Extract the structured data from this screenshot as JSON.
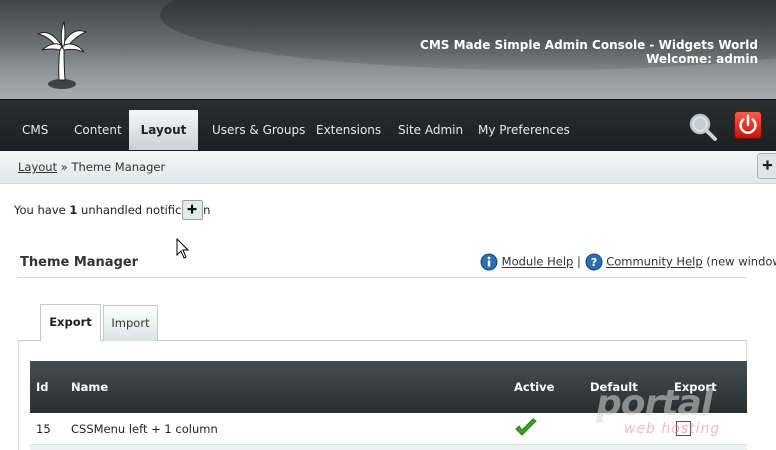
{
  "header": {
    "console_title": "CMS Made Simple Admin Console - Widgets World",
    "welcome": "Welcome: admin",
    "logo_icon": "palm-tree-icon"
  },
  "nav": {
    "items": [
      {
        "label": "CMS"
      },
      {
        "label": "Content"
      },
      {
        "label": "Layout",
        "active": true
      },
      {
        "label": "Users & Groups"
      },
      {
        "label": "Extensions"
      },
      {
        "label": "Site Admin"
      },
      {
        "label": "My Preferences"
      }
    ],
    "search_icon": "magnifier-icon",
    "logout_icon": "power-icon"
  },
  "breadcrumb": {
    "root": "Layout",
    "separator": "»",
    "current": "Theme Manager"
  },
  "notification": {
    "prefix": "You have",
    "count": "1",
    "suffix": "unhandled notification"
  },
  "section": {
    "title": "Theme Manager",
    "module_help": "Module Help",
    "separator": "|",
    "community_help": "Community Help",
    "community_note": "(new window)"
  },
  "tabs": {
    "export": "Export",
    "import": "Import"
  },
  "table": {
    "columns": [
      "Id",
      "Name",
      "Active",
      "Default",
      "Export"
    ],
    "rows": [
      {
        "id": "15",
        "name": "CSSMenu left + 1 column",
        "active": true,
        "default": false,
        "export": false
      }
    ]
  },
  "watermark": {
    "brand": "portal",
    "tagline": "web hosting"
  },
  "colors": {
    "navbar": "#1c1f20",
    "active_tab": "#c9d2d4",
    "table_header": "#2a2e30",
    "power_button": "#d9241a",
    "check": "#3fa126"
  }
}
